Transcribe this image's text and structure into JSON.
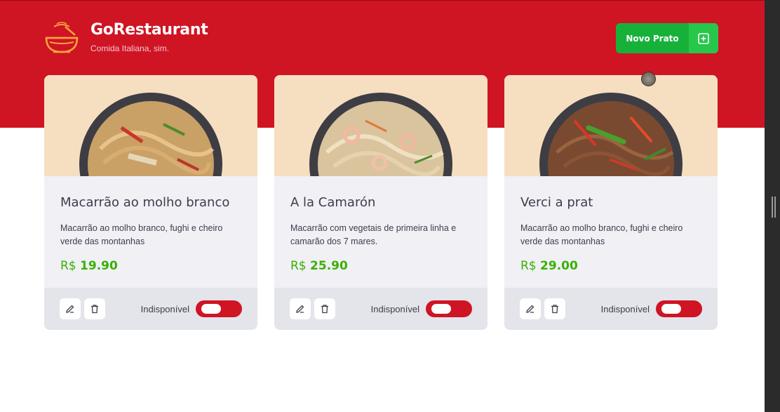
{
  "app": {
    "title": "GoRestaurant",
    "subtitle": "Comida Italiana, sim.",
    "logo_icon": "bowl-icon"
  },
  "header": {
    "new_button_label": "Novo Prato",
    "new_button_icon": "plus-square-icon"
  },
  "colors": {
    "header_red": "#cf1424",
    "accent_green": "#39b100",
    "button_green": "#17b13a",
    "card_bg": "#f0f0f5",
    "footer_bg": "#e4e4eb"
  },
  "dishes": [
    {
      "name": "Macarrão ao molho branco",
      "description": "Macarrão ao molho branco, fughi e cheiro verde das montanhas",
      "currency": "R$",
      "price": "19.90",
      "availability_label": "Indisponível",
      "available": false
    },
    {
      "name": "A la Camarón",
      "description": "Macarrão com vegetais de primeira linha e camarão dos 7 mares.",
      "currency": "R$",
      "price": "25.90",
      "availability_label": "Indisponível",
      "available": false
    },
    {
      "name": "Verci a prat",
      "description": "Macarrão ao molho branco, fughi e cheiro verde das montanhas",
      "currency": "R$",
      "price": "29.00",
      "availability_label": "Indisponível",
      "available": false
    }
  ],
  "card_actions": {
    "edit_icon": "pencil-icon",
    "delete_icon": "trash-icon"
  }
}
